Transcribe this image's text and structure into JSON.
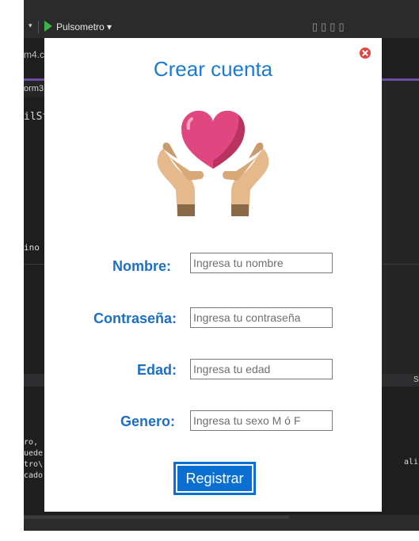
{
  "ide": {
    "run_label": "Pulsometro ▾",
    "tab_file": "m4.c",
    "subtab": "orm3",
    "code_line1": "ilSt",
    "code_line2": "ino",
    "sp_tab": "SP",
    "output_lines": [
      "ro, ",
      "uede",
      "tro\\",
      "cado"
    ],
    "output_right": "ali"
  },
  "dialog": {
    "title": "Crear cuenta",
    "fields": [
      {
        "label": "Nombre:",
        "placeholder": "Ingresa tu nombre",
        "value": ""
      },
      {
        "label": "Contraseña:",
        "placeholder": "Ingresa tu contraseña",
        "value": ""
      },
      {
        "label": "Edad:",
        "placeholder": "Ingresa tu edad",
        "value": ""
      },
      {
        "label": "Genero:",
        "placeholder": "Ingresa tu sexo M ó F",
        "value": ""
      }
    ],
    "submit_label": "Registrar",
    "close_icon": "close-icon",
    "illustration_icon": "heart-in-hands-icon"
  },
  "colors": {
    "accent": "#1a7bd3",
    "label": "#1a6fc9",
    "button": "#0b6fd1",
    "close": "#e0463f",
    "heart": "#e0467f"
  }
}
